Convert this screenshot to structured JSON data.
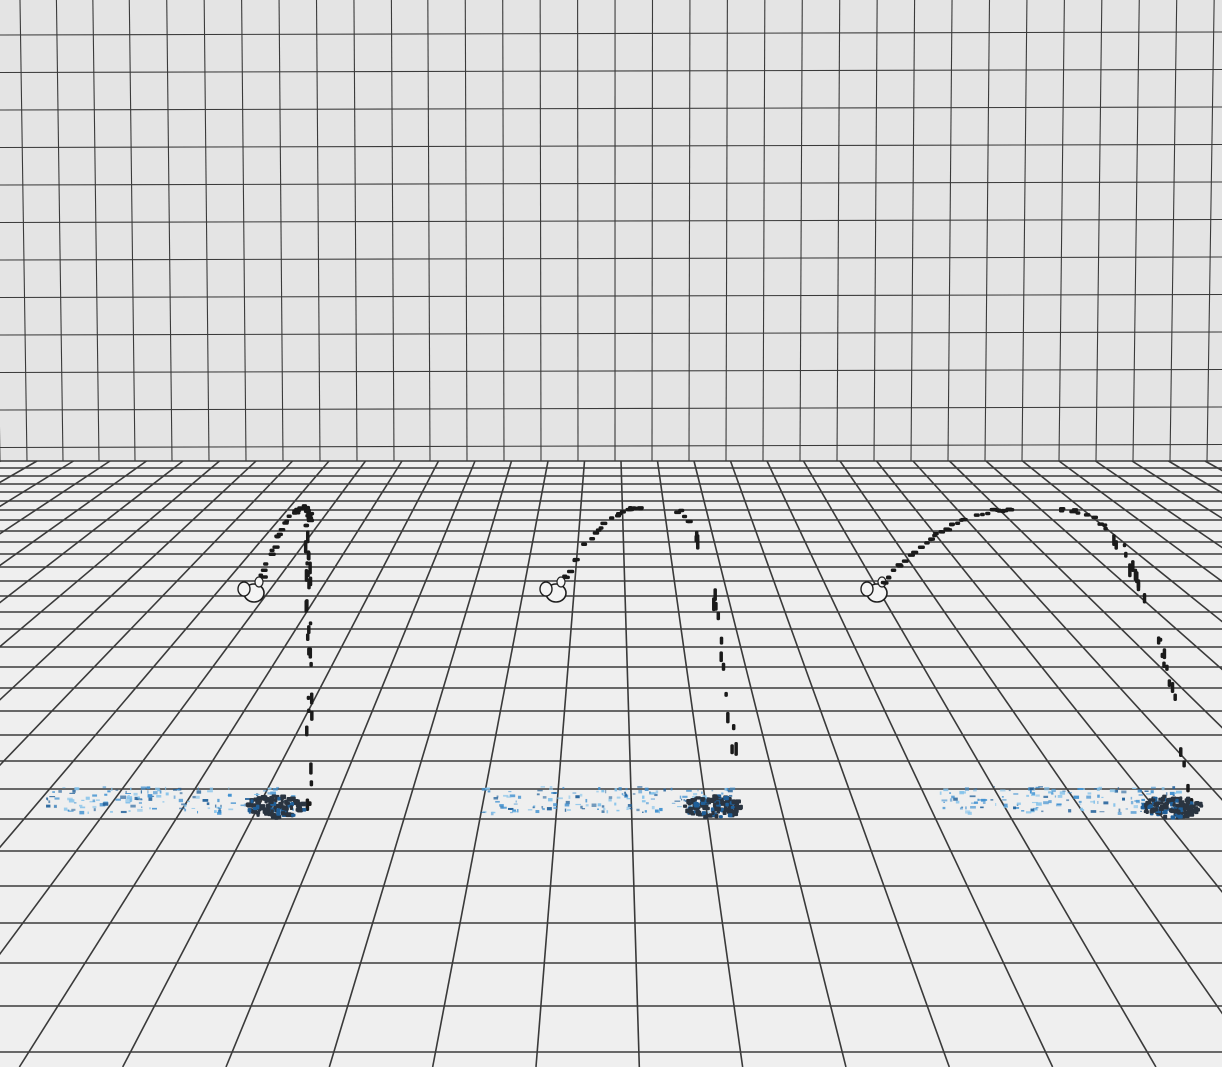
{
  "scene": {
    "kind": "3d-simulation-render",
    "background": {
      "wall_color": "#e4e4e4",
      "floor_color": "#efefef",
      "grid_line_color": "#3a3a3a"
    },
    "particle_colors": {
      "trail_particles": "#1a1a1a",
      "splash_dark": "#2a3440",
      "splash_blue_light": "#7fc0ea",
      "splash_blue_mid": "#3d8fd0",
      "splash_blue_dark": "#1f5f99",
      "emitter_body": "#f4f4f4",
      "emitter_outline": "#1e1e1e"
    },
    "sim_count": 3,
    "sims": [
      {
        "label": ""
      },
      {
        "label": ""
      },
      {
        "label": ""
      }
    ]
  }
}
